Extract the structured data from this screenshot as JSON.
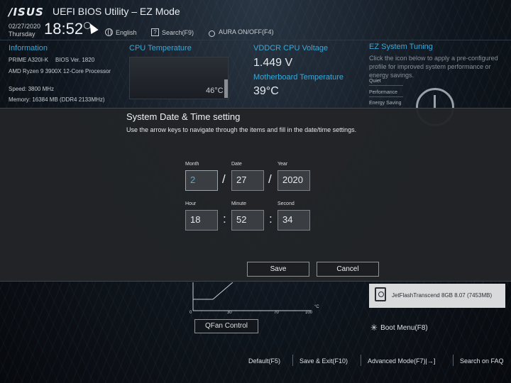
{
  "header": {
    "logo": "/ISUS",
    "title": "UEFI BIOS Utility – EZ Mode",
    "date": "02/27/2020",
    "weekday": "Thursday",
    "time": "18:52",
    "language": "English",
    "search": "Search(F9)",
    "aura": "AURA ON/OFF(F4)"
  },
  "information": {
    "title": "Information",
    "board": "PRIME A320I-K",
    "bios": "BIOS Ver. 1820",
    "cpu": "AMD Ryzen 9 3900X 12-Core Processor",
    "speed": "Speed: 3800 MHz",
    "memory": "Memory: 16384 MB (DDR4 2133MHz)"
  },
  "cpu_temp": {
    "title": "CPU Temperature",
    "value": "46°C"
  },
  "vddcr": {
    "title": "VDDCR CPU Voltage",
    "value": "1.449 V"
  },
  "mb_temp": {
    "title": "Motherboard Temperature",
    "value": "39°C"
  },
  "ez_tuning": {
    "title": "EZ System Tuning",
    "desc": "Click the icon below to apply a pre-configured profile for improved system performance or energy savings.",
    "quiet": "Quiet",
    "performance": "Performance",
    "energy": "Energy Saving"
  },
  "modal": {
    "title": "System Date & Time setting",
    "desc": "Use the arrow keys to navigate through the items and fill in the date/time settings.",
    "month_label": "Month",
    "date_label": "Date",
    "year_label": "Year",
    "hour_label": "Hour",
    "minute_label": "Minute",
    "second_label": "Second",
    "month": "2",
    "date": "27",
    "year": "2020",
    "hour": "18",
    "minute": "52",
    "second": "34",
    "slash": "/",
    "colon": ":",
    "save": "Save",
    "cancel": "Cancel"
  },
  "fan": {
    "ticks": [
      "0",
      "30",
      "70",
      "100"
    ],
    "unit": "°C",
    "qfan": "QFan Control"
  },
  "boot": {
    "device": "JetFlashTranscend 8GB 8.07  (7453MB)",
    "menu": "Boot Menu(F8)"
  },
  "footer": {
    "default": "Default(F5)",
    "save_exit": "Save & Exit(F10)",
    "advanced": "Advanced Mode(F7)|→]",
    "faq": "Search on FAQ"
  }
}
